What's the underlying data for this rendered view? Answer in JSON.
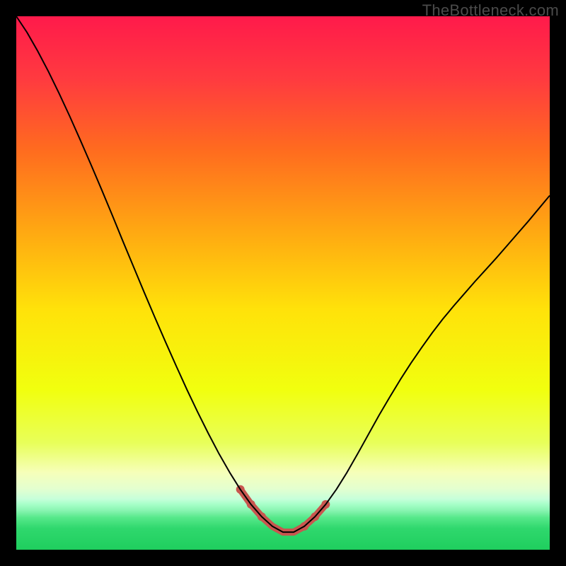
{
  "watermark": "TheBottleneck.com",
  "chart_data": {
    "type": "line",
    "title": "",
    "xlabel": "",
    "ylabel": "",
    "xlim": [
      0,
      100
    ],
    "ylim": [
      0,
      100
    ],
    "grid": false,
    "background_gradient": {
      "stops": [
        {
          "offset": 0.0,
          "color": "#ff1a4b"
        },
        {
          "offset": 0.12,
          "color": "#ff3b3f"
        },
        {
          "offset": 0.25,
          "color": "#ff6b1f"
        },
        {
          "offset": 0.4,
          "color": "#ffa712"
        },
        {
          "offset": 0.55,
          "color": "#ffe20a"
        },
        {
          "offset": 0.7,
          "color": "#f1ff0e"
        },
        {
          "offset": 0.8,
          "color": "#e8ff5a"
        },
        {
          "offset": 0.855,
          "color": "#f6ffb9"
        },
        {
          "offset": 0.885,
          "color": "#e4ffcf"
        },
        {
          "offset": 0.905,
          "color": "#c6ffda"
        },
        {
          "offset": 0.915,
          "color": "#a6ffc8"
        },
        {
          "offset": 0.926,
          "color": "#8af5b2"
        },
        {
          "offset": 0.94,
          "color": "#56e88a"
        },
        {
          "offset": 0.96,
          "color": "#2fd86d"
        },
        {
          "offset": 1.0,
          "color": "#1fce5e"
        }
      ]
    },
    "series": [
      {
        "name": "bottleneck-curve",
        "color": "#000000",
        "width": 2.0,
        "x": [
          0,
          2,
          4,
          6,
          8,
          10,
          12,
          14,
          16,
          18,
          20,
          22,
          24,
          26,
          28,
          30,
          32,
          34,
          36,
          38,
          40,
          42,
          44,
          46,
          48,
          50,
          52,
          54,
          56,
          58,
          60,
          62,
          64,
          66,
          68,
          70,
          72,
          74,
          76,
          78,
          80,
          82,
          84,
          86,
          88,
          90,
          92,
          94,
          96,
          98,
          100
        ],
        "y": [
          100.0,
          97.0,
          93.5,
          89.7,
          85.6,
          81.3,
          76.8,
          72.2,
          67.5,
          62.7,
          57.8,
          53.0,
          48.2,
          43.5,
          38.9,
          34.4,
          30.0,
          25.8,
          21.8,
          18.0,
          14.5,
          11.3,
          8.5,
          6.2,
          4.4,
          3.3,
          3.3,
          4.4,
          6.2,
          8.5,
          11.3,
          14.5,
          18.0,
          21.6,
          25.2,
          28.6,
          31.9,
          35.0,
          37.9,
          40.7,
          43.3,
          45.7,
          48.0,
          50.3,
          52.5,
          54.7,
          57.0,
          59.3,
          61.6,
          64.0,
          66.4
        ]
      }
    ],
    "highlight_segment": {
      "color": "#c8564f",
      "width": 10,
      "x": [
        42,
        44,
        46,
        48,
        50,
        52,
        54,
        56,
        58
      ],
      "y": [
        11.3,
        8.5,
        6.2,
        4.4,
        3.3,
        3.3,
        4.4,
        6.2,
        8.5
      ]
    },
    "highlight_dots": {
      "color": "#c8564f",
      "radius": 6,
      "points": [
        {
          "x": 42,
          "y": 11.3
        },
        {
          "x": 44,
          "y": 8.5
        },
        {
          "x": 46,
          "y": 6.2
        },
        {
          "x": 54,
          "y": 4.4
        },
        {
          "x": 56,
          "y": 6.2
        },
        {
          "x": 58,
          "y": 8.5
        }
      ]
    }
  }
}
